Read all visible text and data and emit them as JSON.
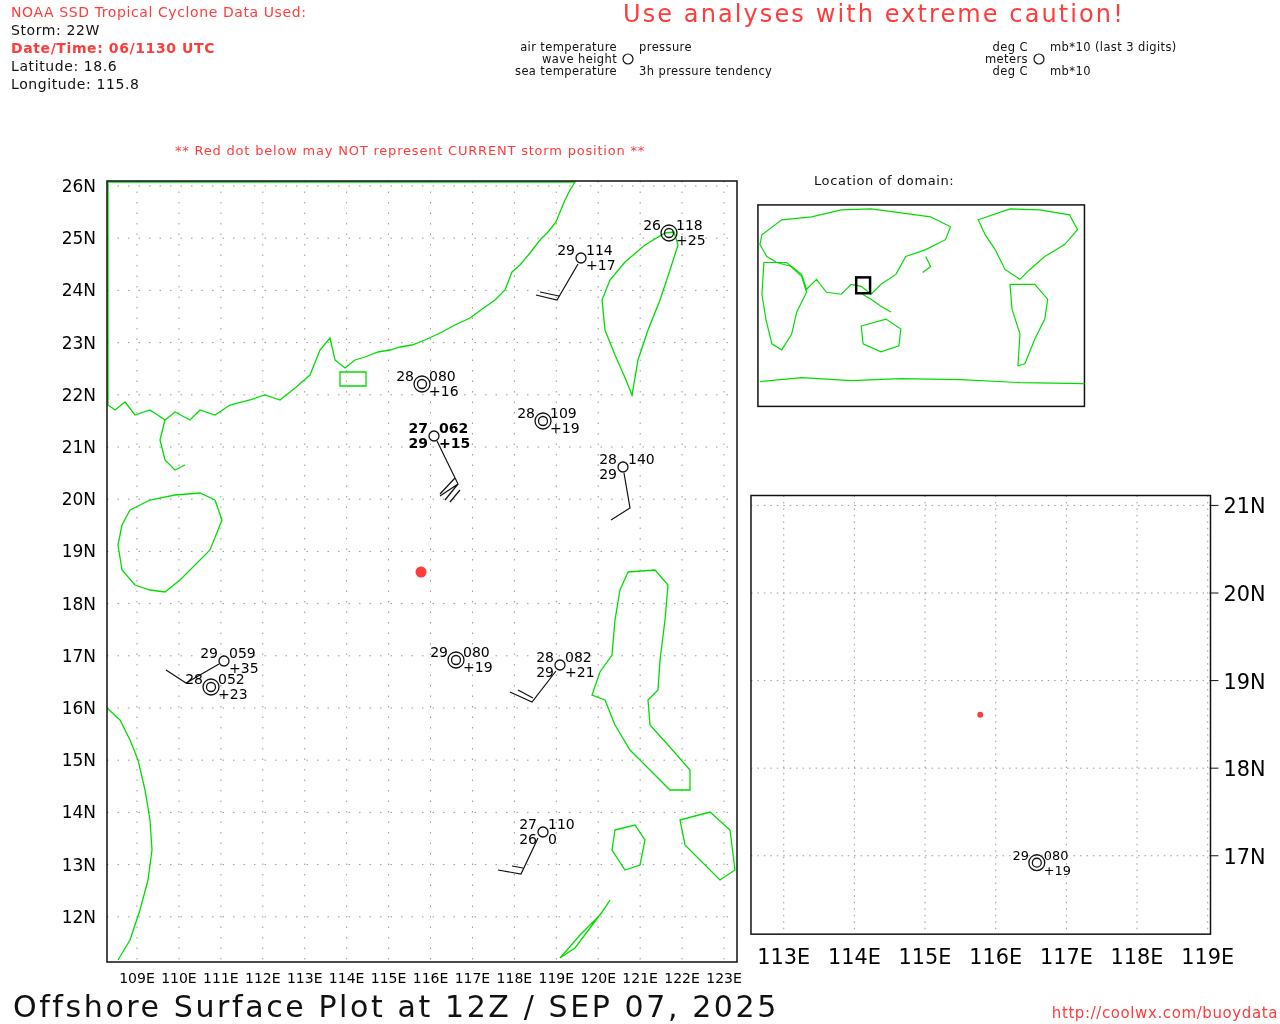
{
  "header": {
    "source": "NOAA SSD Tropical Cyclone Data Used:",
    "storm": "Storm: 22W",
    "datetime": "Date/Time: 06/1130 UTC",
    "latitude": "Latitude: 18.6",
    "longitude": "Longitude: 115.8",
    "caution": "Use analyses with extreme caution!"
  },
  "legend": {
    "air_temperature": "air temperature",
    "wave_height": "wave height",
    "sea_temperature": "sea temperature",
    "pressure": "pressure",
    "tendency": "3h pressure tendency"
  },
  "units": {
    "air_temperature": "deg C",
    "wave_height": "meters",
    "sea_temperature": "deg C",
    "pressure": "mb*10 (last 3 digits)",
    "tendency": "mb*10"
  },
  "notice": "** Red dot below may NOT represent CURRENT storm position **",
  "main_map": {
    "lat_labels": [
      "26N",
      "25N",
      "24N",
      "23N",
      "22N",
      "21N",
      "20N",
      "19N",
      "18N",
      "17N",
      "16N",
      "15N",
      "14N",
      "13N",
      "12N"
    ],
    "lon_labels": [
      "109E",
      "110E",
      "111E",
      "112E",
      "113E",
      "114E",
      "115E",
      "116E",
      "117E",
      "118E",
      "119E",
      "120E",
      "121E",
      "122E",
      "123E"
    ],
    "stations": [
      {
        "kind": "wave",
        "bold": false,
        "air_temp": "26",
        "pressure": "118",
        "tendency": "+25"
      },
      {
        "kind": "plain",
        "bold": false,
        "air_temp": "29",
        "pressure": "114",
        "tendency": "+17"
      },
      {
        "kind": "wave",
        "bold": false,
        "air_temp": "28",
        "pressure": "080",
        "tendency": "+16"
      },
      {
        "kind": "wave",
        "bold": false,
        "air_temp": "28",
        "pressure": "109",
        "tendency": "+19"
      },
      {
        "kind": "plain",
        "bold": true,
        "air_temp": "27",
        "pressure": "062",
        "sea_temp": "29",
        "tendency": "+15"
      },
      {
        "kind": "plain",
        "bold": false,
        "air_temp": "28",
        "pressure": "140",
        "sea_temp": "29"
      },
      {
        "kind": "plain",
        "bold": false,
        "air_temp": "29",
        "pressure": "059",
        "tendency": "+35"
      },
      {
        "kind": "wave",
        "bold": false,
        "air_temp": "28",
        "pressure": "052",
        "tendency": "+23"
      },
      {
        "kind": "wave",
        "bold": false,
        "air_temp": "29",
        "pressure": "080",
        "tendency": "+19"
      },
      {
        "kind": "plain",
        "bold": false,
        "air_temp": "28",
        "pressure": "082",
        "sea_temp": "29",
        "tendency": "+21"
      },
      {
        "kind": "plain",
        "bold": false,
        "air_temp": "27",
        "pressure": "110",
        "sea_temp": "26",
        "tendency": "0"
      }
    ]
  },
  "inset": {
    "title": "Location of domain:"
  },
  "zoom_map": {
    "lat_labels": [
      "21N",
      "20N",
      "19N",
      "18N",
      "17N"
    ],
    "lon_labels": [
      "113E",
      "114E",
      "115E",
      "116E",
      "117E",
      "118E",
      "119E"
    ],
    "stations": [
      {
        "kind": "wave",
        "bold": false,
        "air_temp": "29",
        "pressure": "080",
        "tendency": "+19"
      }
    ]
  },
  "footer": {
    "title": "Offshore Surface Plot at 12Z / SEP 07, 2025",
    "url": "http://coolwx.com/buoydata"
  }
}
